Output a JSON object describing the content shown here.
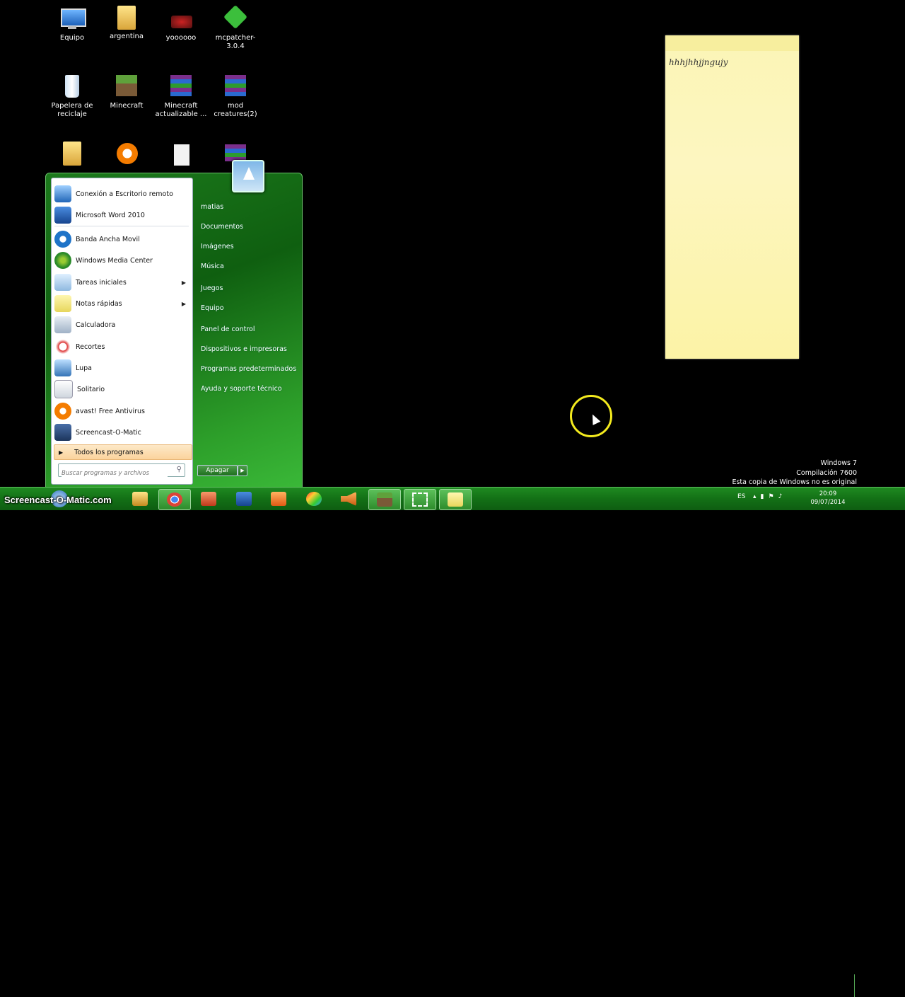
{
  "desktop_icons": [
    {
      "label": "Equipo",
      "icon": "computer-icon"
    },
    {
      "label": "argentina",
      "icon": "folder-icon"
    },
    {
      "label": "yoooooo",
      "icon": "image-icon"
    },
    {
      "label": "mcpatcher-3.0.4",
      "icon": "mcpatcher-icon"
    },
    {
      "label": "Papelera de reciclaje",
      "icon": "recycle-bin-icon"
    },
    {
      "label": "Minecraft",
      "icon": "minecraft-icon"
    },
    {
      "label": "Minecraft actualizable ...",
      "icon": "winrar-icon"
    },
    {
      "label": "mod creatures(2)",
      "icon": "winrar-icon"
    },
    {
      "label": "",
      "icon": "folder-icon"
    },
    {
      "label": "",
      "icon": "avast-icon"
    },
    {
      "label": "",
      "icon": "document-icon"
    },
    {
      "label": "",
      "icon": "winrar-icon"
    }
  ],
  "sticky_note": {
    "text": "hhhjhhjjngujy"
  },
  "start_menu": {
    "programs": [
      {
        "label": "Conexión a Escritorio remoto",
        "icon": "remote-desktop-icon",
        "submenu": false
      },
      {
        "label": "Microsoft Word 2010",
        "icon": "word-icon",
        "submenu": false
      },
      {
        "label": "Banda Ancha Movil",
        "icon": "internet-explorer-icon",
        "submenu": false
      },
      {
        "label": "Windows Media Center",
        "icon": "media-center-icon",
        "submenu": false
      },
      {
        "label": "Tareas iniciales",
        "icon": "getting-started-icon",
        "submenu": true
      },
      {
        "label": "Notas rápidas",
        "icon": "sticky-notes-icon",
        "submenu": true
      },
      {
        "label": "Calculadora",
        "icon": "calculator-icon",
        "submenu": false
      },
      {
        "label": "Recortes",
        "icon": "snipping-tool-icon",
        "submenu": false
      },
      {
        "label": "Lupa",
        "icon": "magnifier-icon",
        "submenu": false
      },
      {
        "label": "Solitario",
        "icon": "solitaire-icon",
        "submenu": false
      },
      {
        "label": "avast! Free Antivirus",
        "icon": "avast-icon",
        "submenu": false
      },
      {
        "label": "Screencast-O-Matic",
        "icon": "screencast-icon",
        "submenu": false
      }
    ],
    "all_programs": "Todos los programas",
    "search_placeholder": "Buscar programas y archivos",
    "right_items": [
      "matias",
      "Documentos",
      "Imágenes",
      "Música",
      "Juegos",
      "Equipo",
      "Panel de control",
      "Dispositivos e impresoras",
      "Programas predeterminados",
      "Ayuda y soporte técnico"
    ],
    "shutdown": "Apagar"
  },
  "taskbar": {
    "watermark": "Screencast-O-Matic.com",
    "buttons": [
      "explorer-icon",
      "chrome-icon",
      "powerpoint-icon",
      "word-icon",
      "media-player-icon",
      "paint-icon",
      "volume-app-icon",
      "minecraft-icon",
      "snipping-tool-icon",
      "sticky-notes-icon"
    ],
    "language": "ES",
    "time": "20:09",
    "date": "09/07/2014"
  },
  "windows_notice": {
    "line1": "Windows 7",
    "line2": "Compilación  7600",
    "line3": "Esta copia de Windows no es original"
  }
}
